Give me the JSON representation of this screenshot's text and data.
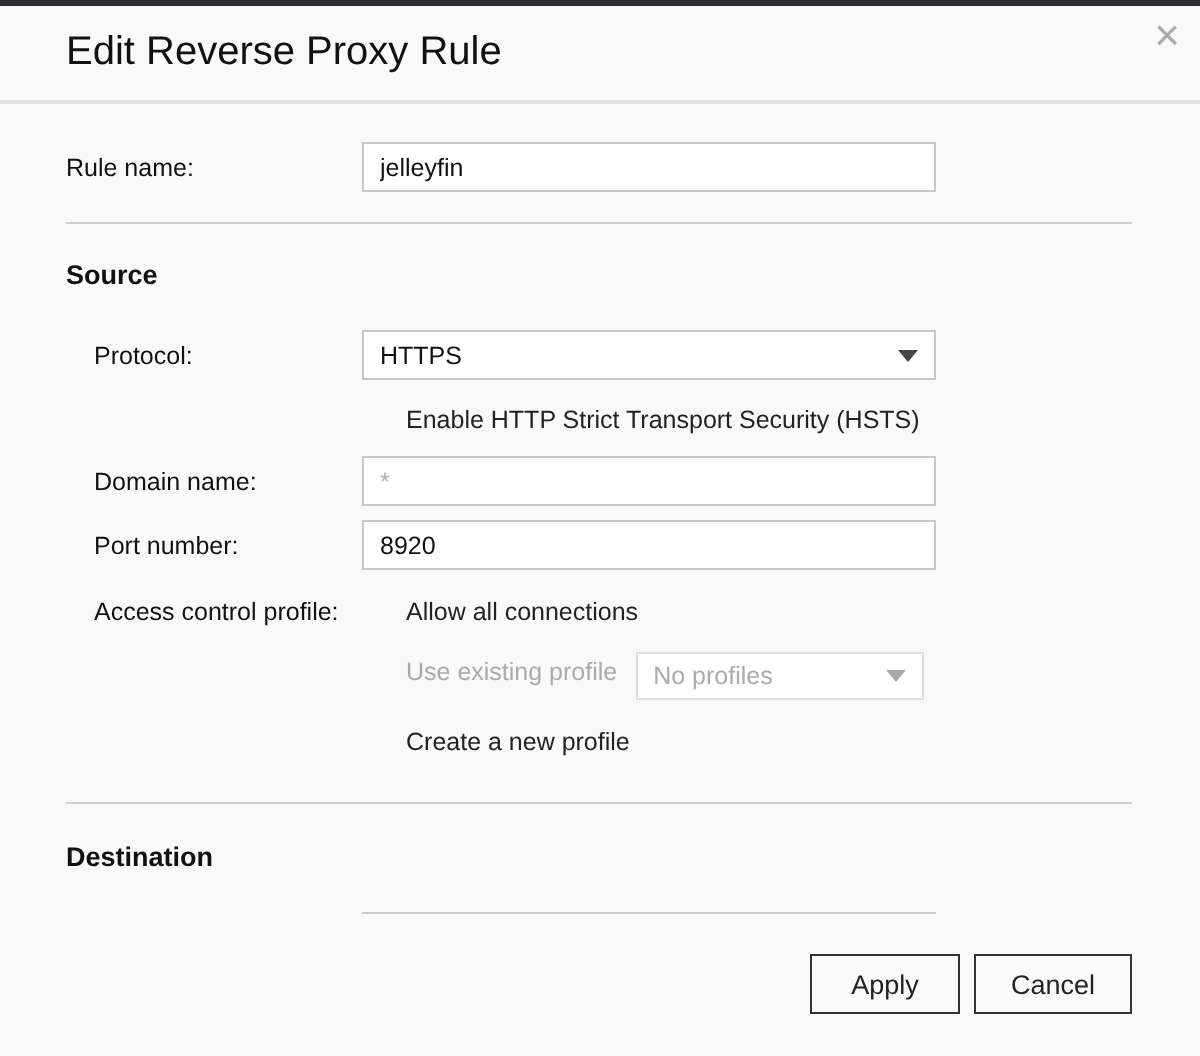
{
  "dialog": {
    "title": "Edit Reverse Proxy Rule",
    "close": "×"
  },
  "rule_name": {
    "label": "Rule name:",
    "value": "jelleyfin"
  },
  "source": {
    "heading": "Source",
    "fields": [
      {
        "kind": "select",
        "label": "Protocol:",
        "value": "HTTPS"
      },
      {
        "kind": "note",
        "text": "Enable HTTP Strict Transport Security (HSTS)"
      },
      {
        "kind": "input",
        "label": "Domain name:",
        "placeholder": "*"
      },
      {
        "kind": "input",
        "label": "Port number:",
        "value": "8920"
      }
    ],
    "access_control": {
      "label": "Access control profile:",
      "options": [
        {
          "kind": "text",
          "label": "Allow all connections",
          "disabled": false
        },
        {
          "kind": "select",
          "label": "Use existing profile",
          "value": "No profiles",
          "disabled": true
        },
        {
          "kind": "text",
          "label": "Create a new profile",
          "disabled": false
        }
      ]
    }
  },
  "destination": {
    "heading": "Destination"
  },
  "buttons": [
    "Apply",
    "Cancel"
  ]
}
